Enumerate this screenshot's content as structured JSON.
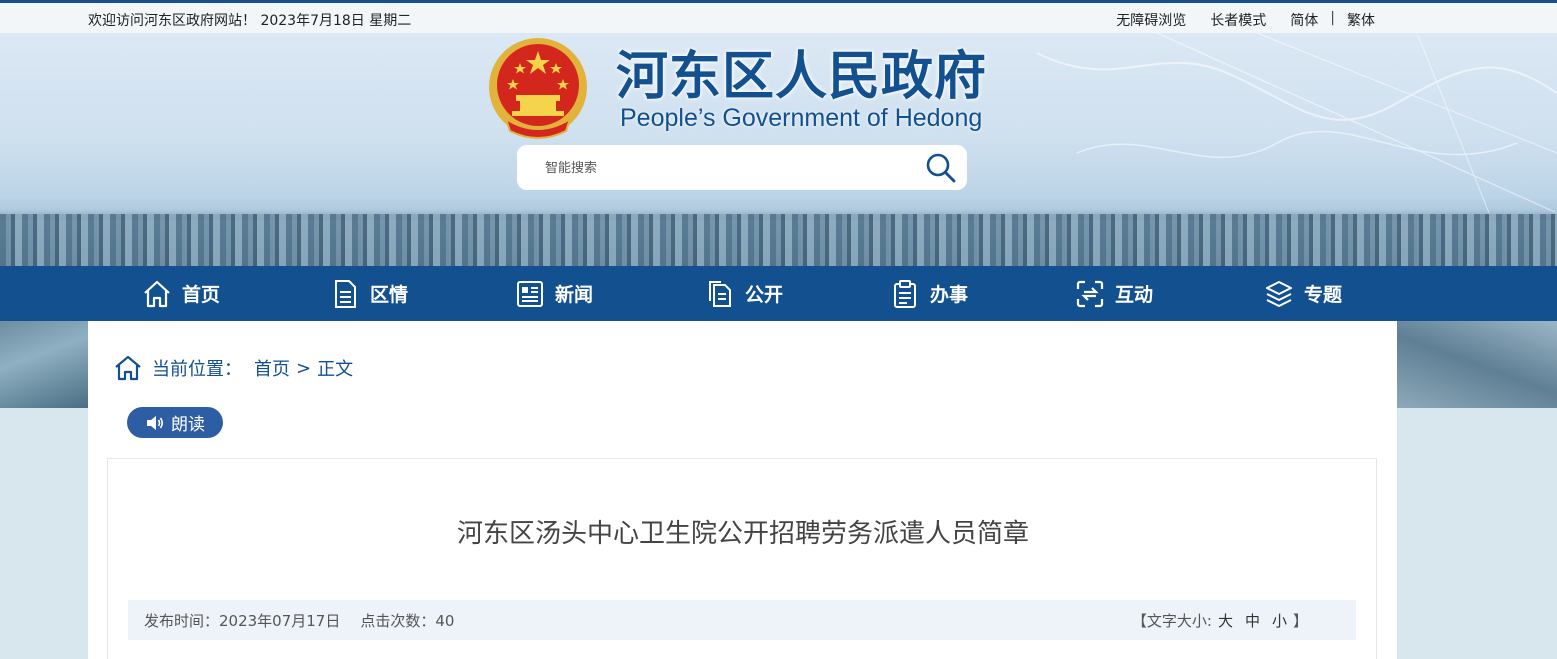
{
  "topbar": {
    "welcome": "欢迎访问河东区政府网站！ 2023年7月18日  星期二",
    "accessible": "无障碍浏览",
    "elder_mode": "长者模式",
    "simplified": "简体",
    "separator": "|",
    "traditional": "繁体"
  },
  "header": {
    "title": "河东区人民政府",
    "subtitle": "People’s Government of Hedong"
  },
  "search": {
    "placeholder": "智能搜索"
  },
  "nav": {
    "items": [
      {
        "label": "首页",
        "icon": "home-icon"
      },
      {
        "label": "区情",
        "icon": "document-icon"
      },
      {
        "label": "新闻",
        "icon": "news-icon"
      },
      {
        "label": "公开",
        "icon": "files-icon"
      },
      {
        "label": "办事",
        "icon": "clipboard-icon"
      },
      {
        "label": "互动",
        "icon": "interact-icon"
      },
      {
        "label": "专题",
        "icon": "layers-icon"
      }
    ]
  },
  "breadcrumb": {
    "label": "当前位置：",
    "home": "首页",
    "sep": ">",
    "current": "正文"
  },
  "read_button": "朗读",
  "article": {
    "title": "河东区汤头中心卫生院公开招聘劳务派遣人员简章",
    "publish_time": "发布时间：2023年07月17日",
    "clicks": "点击次数：40",
    "font_size_open": "【文字大小:",
    "font_large": "大",
    "font_medium": "中",
    "font_small": "小",
    "font_size_close": "】"
  },
  "colors": {
    "primary": "#12508f",
    "read_button": "#2d5ea3",
    "meta_bg": "#eef3f9"
  }
}
